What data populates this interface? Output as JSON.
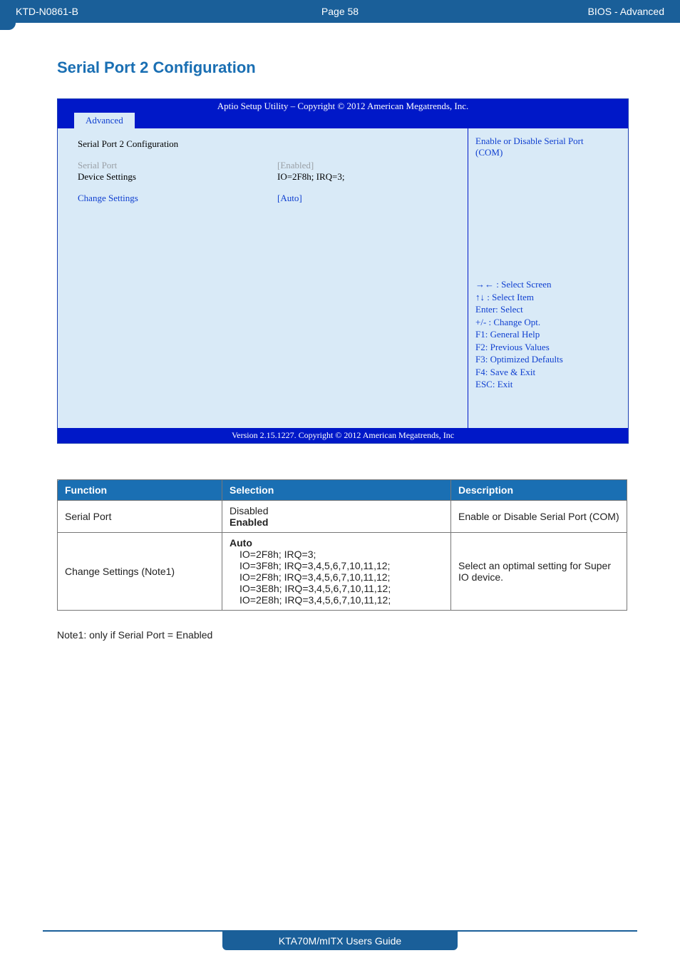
{
  "topbar": {
    "left": "KTD-N0861-B",
    "center": "Page 58",
    "right": "BIOS  - Advanced"
  },
  "section_title": "Serial Port 2 Configuration",
  "bios": {
    "title": "Aptio Setup Utility  –   Copyright © 2012 American Megatrends, Inc.",
    "tab": "Advanced",
    "rows": {
      "heading": "Serial Port 2 Configuration",
      "serial_port_label": "Serial Port",
      "serial_port_value": "[Enabled]",
      "device_settings_label": "Device Settings",
      "device_settings_value": "IO=2F8h; IRQ=3;",
      "change_settings_label": "Change Settings",
      "change_settings_value": "[Auto]"
    },
    "help_top_line1": "Enable or Disable Serial Port",
    "help_top_line2": "(COM)",
    "keys": {
      "k1": "→← : Select Screen",
      "k2": "↑↓ : Select Item",
      "k3": "Enter: Select",
      "k4": "+/- : Change Opt.",
      "k5": "F1: General Help",
      "k6": "F2: Previous Values",
      "k7": "F3: Optimized Defaults",
      "k8": "F4: Save & Exit",
      "k9": "ESC: Exit"
    },
    "footer": "Version 2.15.1227. Copyright © 2012 American Megatrends, Inc"
  },
  "table": {
    "headers": {
      "c1": "Function",
      "c2": "Selection",
      "c3": "Description"
    },
    "row1": {
      "func": "Serial Port",
      "sel_line1": "Disabled",
      "sel_line2": "Enabled",
      "desc": "Enable or Disable Serial Port (COM)"
    },
    "row2": {
      "func": "Change Settings  (Note1)",
      "sel_line1": "Auto",
      "sel_line2": "IO=2F8h; IRQ=3;",
      "sel_line3": "IO=3F8h; IRQ=3,4,5,6,7,10,11,12;",
      "sel_line4": "IO=2F8h; IRQ=3,4,5,6,7,10,11,12;",
      "sel_line5": "IO=3E8h; IRQ=3,4,5,6,7,10,11,12;",
      "sel_line6": "IO=2E8h; IRQ=3,4,5,6,7,10,11,12;",
      "desc": "Select an optimal setting for Super IO device."
    }
  },
  "note": "Note1: only if Serial Port = Enabled",
  "page_footer": "KTA70M/mITX Users Guide"
}
